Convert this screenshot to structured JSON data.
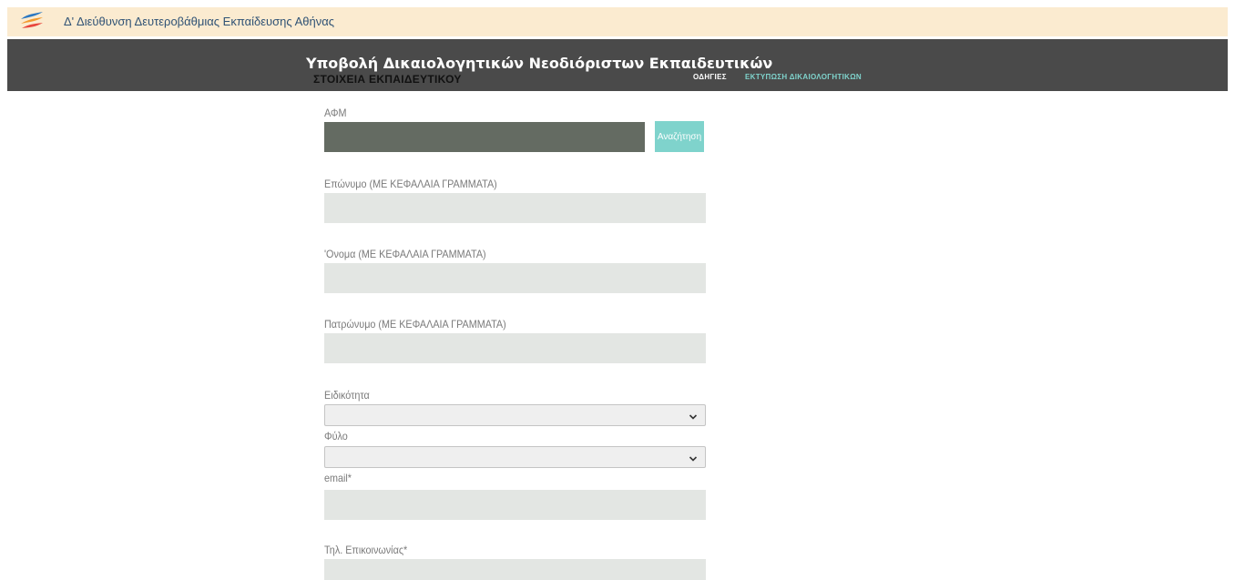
{
  "topbar": {
    "site_title": "Δ' Διεύθυνση Δευτεροβάθμιας Εκπαίδευσης Αθήνας"
  },
  "header": {
    "title": "Υποβολή Δικαιολογητικών Νεοδιόριστων Εκπαιδευτικών",
    "section": "ΣΤΟΙΧΕΙΑ ΕΚΠΑΙΔΕΥΤΙΚΟΥ",
    "nav": {
      "guide": "ΟΔΗΓΙΕΣ",
      "print": "ΕΚΤΥΠΩΣΗ ΔΙΚΑΙΟΛΟΓΗΤΙΚΩΝ"
    }
  },
  "form": {
    "afm_label": "ΑΦΜ",
    "afm_value": "",
    "search_label": "Αναζήτηση",
    "surname_label": "Επώνυμο (ΜΕ ΚΕΦΑΛΑΙΑ ΓΡΑΜΜΑΤΑ)",
    "surname_value": "",
    "name_label": "'Ονομα (ΜΕ ΚΕΦΑΛΑΙΑ ΓΡΑΜΜΑΤΑ)",
    "name_value": "",
    "father_label": "Πατρώνυμο (ΜΕ ΚΕΦΑΛΑΙΑ ΓΡΑΜΜΑΤΑ)",
    "father_value": "",
    "specialty_label": "Ειδικότητα",
    "specialty_value": "",
    "gender_label": "Φύλο",
    "gender_value": "",
    "email_label": "email*",
    "email_value": "",
    "phone_label": "Τηλ. Επικοινωνίας*",
    "phone_value": ""
  },
  "colors": {
    "topbar_bg": "#fbebd0",
    "header_bg": "#4a4a4a",
    "accent": "#7fd3cc",
    "input_bg": "#e3e6e3",
    "afm_bg": "#646b62"
  },
  "icons": {
    "logo": "logo-icon",
    "select_chevron": "chevron-down-icon"
  }
}
